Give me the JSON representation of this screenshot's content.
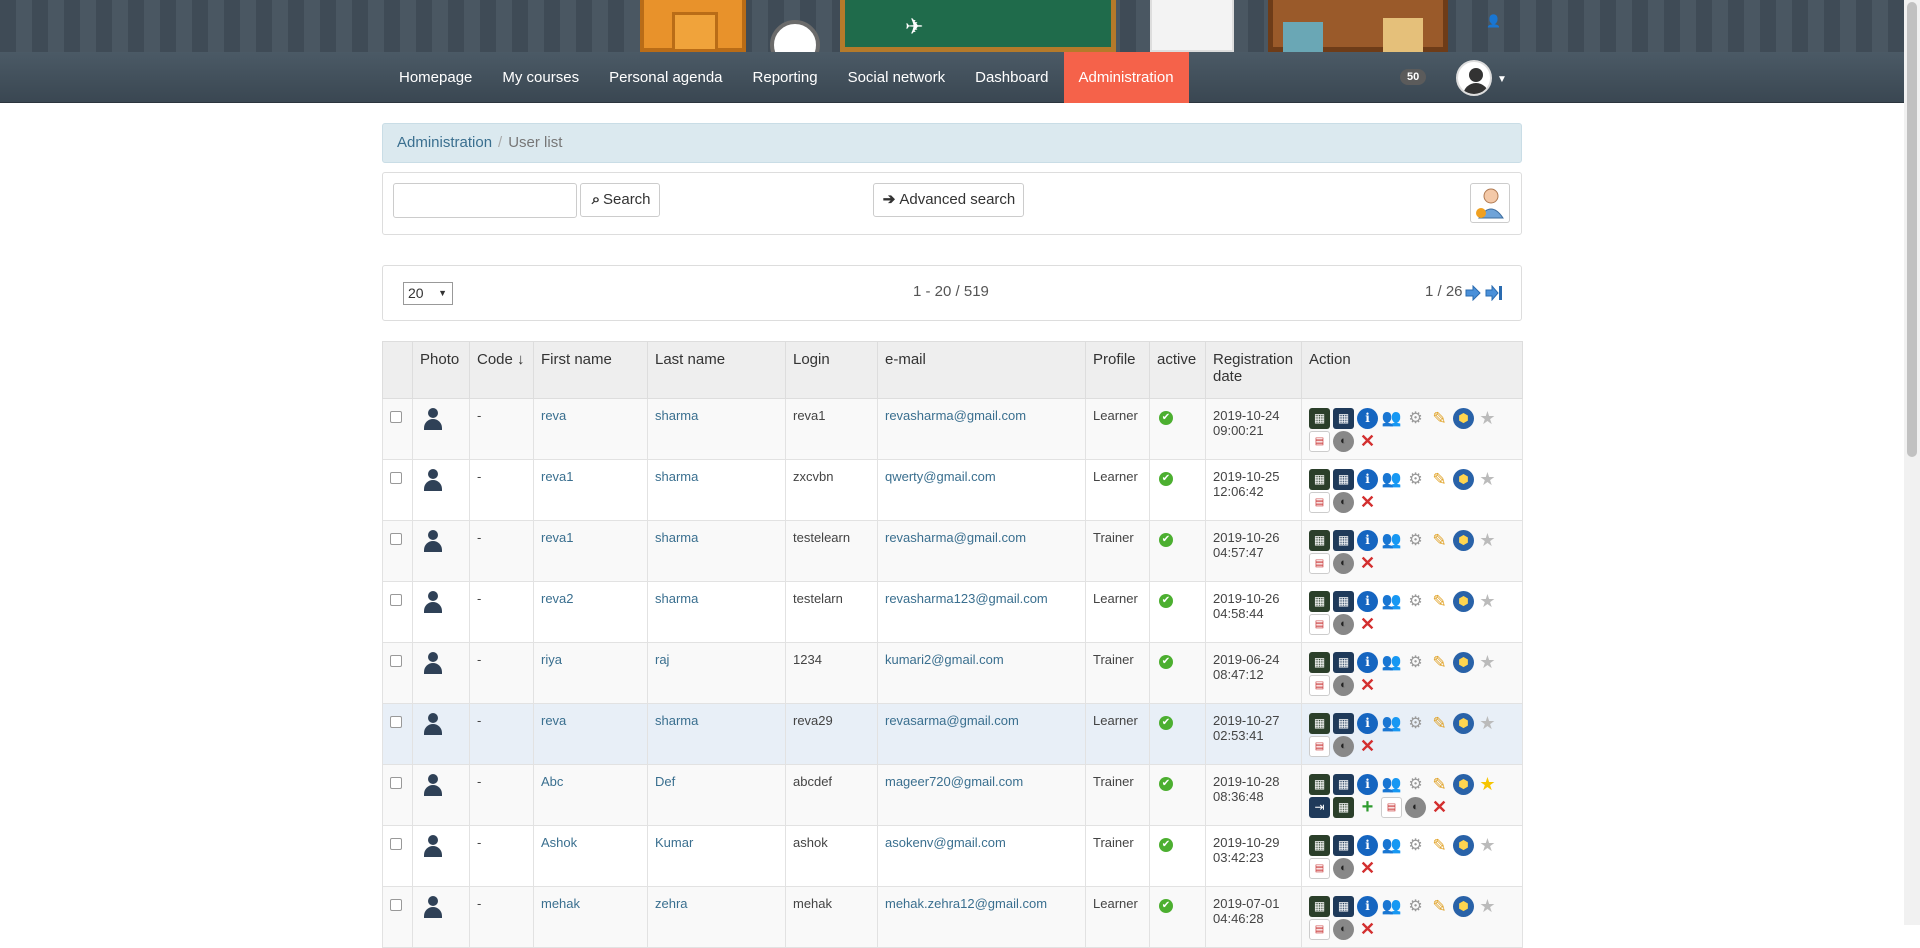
{
  "nav": {
    "items": [
      {
        "label": "Homepage",
        "active": false
      },
      {
        "label": "My courses",
        "active": false
      },
      {
        "label": "Personal agenda",
        "active": false
      },
      {
        "label": "Reporting",
        "active": false
      },
      {
        "label": "Social network",
        "active": false
      },
      {
        "label": "Dashboard",
        "active": false
      },
      {
        "label": "Administration",
        "active": true
      }
    ],
    "badge": "50",
    "active_color": "#f5624a"
  },
  "breadcrumb": {
    "parent": "Administration",
    "separator": "/",
    "current": "User list"
  },
  "search": {
    "value": "",
    "button_label": "Search",
    "advanced_label": "Advanced search"
  },
  "pagination": {
    "per_page": "20",
    "range": "1 - 20 / 519",
    "pages": "1 / 26"
  },
  "table": {
    "columns": [
      "Photo",
      "Code ↓",
      "First name",
      "Last name",
      "Login",
      "e-mail",
      "Profile",
      "active",
      "Registration date",
      "Action"
    ],
    "rows": [
      {
        "code": "-",
        "first": "reva",
        "last": "sharma",
        "login": "reva1",
        "email": "revasharma@gmail.com",
        "profile": "Learner",
        "date": "2019-10-24",
        "time": "09:00:21",
        "extra": false
      },
      {
        "code": "-",
        "first": "reva1",
        "last": "sharma",
        "login": "zxcvbn",
        "email": "qwerty@gmail.com",
        "profile": "Learner",
        "date": "2019-10-25",
        "time": "12:06:42",
        "extra": false
      },
      {
        "code": "-",
        "first": "reva1",
        "last": "sharma",
        "login": "testelearn",
        "email": "revasharma@gmail.com",
        "profile": "Trainer",
        "date": "2019-10-26",
        "time": "04:57:47",
        "extra": false
      },
      {
        "code": "-",
        "first": "reva2",
        "last": "sharma",
        "login": "testelarn",
        "email": "revasharma123@gmail.com",
        "profile": "Learner",
        "date": "2019-10-26",
        "time": "04:58:44",
        "extra": false
      },
      {
        "code": "-",
        "first": "riya",
        "last": "raj",
        "login": "1234",
        "email": "kumari2@gmail.com",
        "profile": "Trainer",
        "date": "2019-06-24",
        "time": "08:47:12",
        "extra": false
      },
      {
        "code": "-",
        "first": "reva",
        "last": "sharma",
        "login": "reva29",
        "email": "revasarma@gmail.com",
        "profile": "Learner",
        "date": "2019-10-27",
        "time": "02:53:41",
        "extra": false
      },
      {
        "code": "-",
        "first": "Abc",
        "last": "Def",
        "login": "abcdef",
        "email": "mageer720@gmail.com",
        "profile": "Trainer",
        "date": "2019-10-28",
        "time": "08:36:48",
        "extra": true
      },
      {
        "code": "-",
        "first": "Ashok",
        "last": "Kumar",
        "login": "ashok",
        "email": "asokenv@gmail.com",
        "profile": "Trainer",
        "date": "2019-10-29",
        "time": "03:42:23",
        "extra": false
      },
      {
        "code": "-",
        "first": "mehak",
        "last": "zehra",
        "login": "mehak",
        "email": "mehak.zehra12@gmail.com",
        "profile": "Learner",
        "date": "2019-07-01",
        "time": "04:46:28",
        "extra": false
      }
    ]
  }
}
